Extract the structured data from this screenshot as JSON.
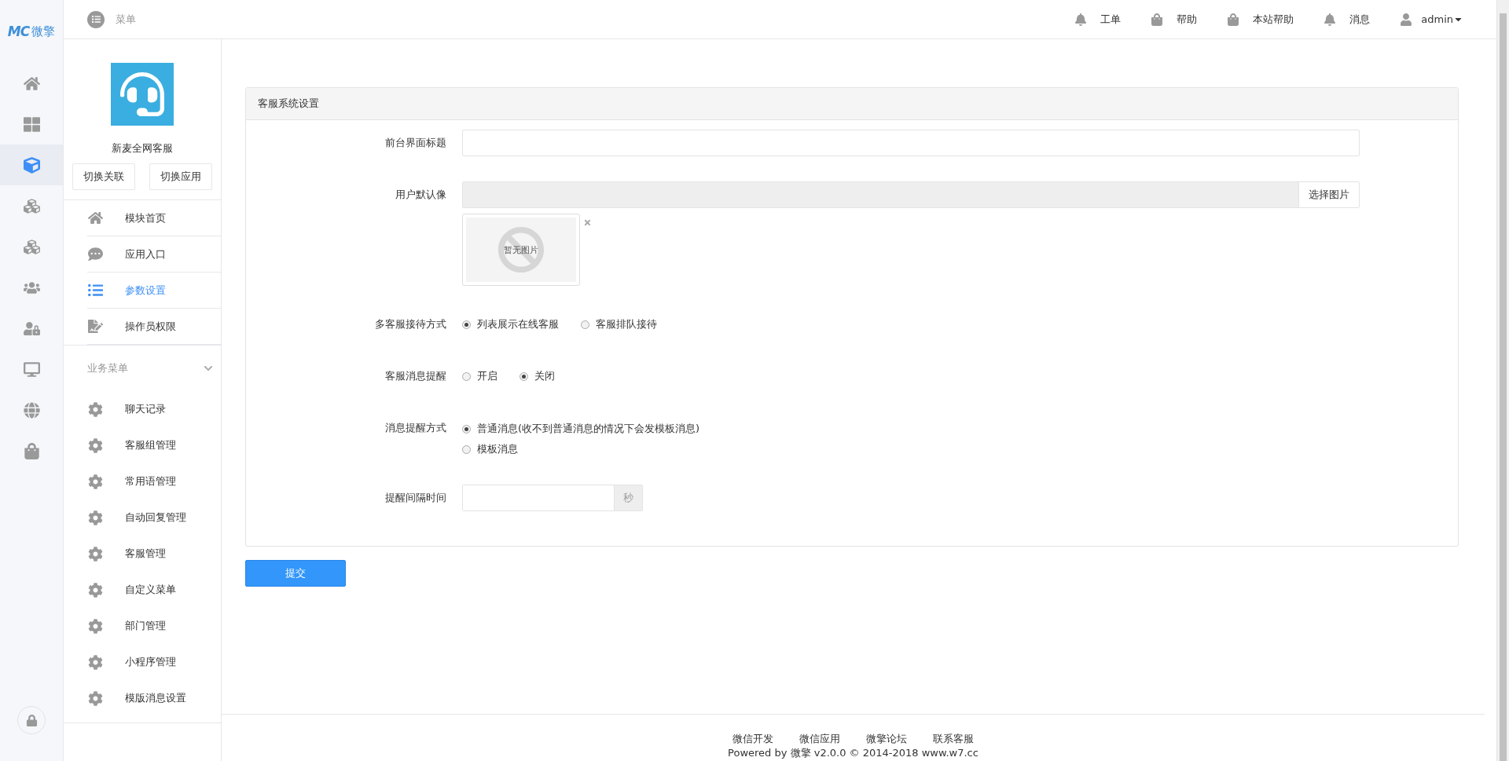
{
  "rail": {
    "logo_mark": "MC",
    "logo_name": "微擎",
    "items": [
      {
        "selected": false
      },
      {
        "selected": false
      },
      {
        "selected": true
      },
      {
        "selected": false
      },
      {
        "selected": false
      },
      {
        "selected": false
      },
      {
        "selected": false
      },
      {
        "selected": false
      },
      {
        "selected": false
      },
      {
        "selected": false
      }
    ]
  },
  "topbar": {
    "menu_label": "菜单",
    "links": [
      {
        "label": "工单",
        "kind": "bell"
      },
      {
        "label": "帮助",
        "kind": "bag"
      },
      {
        "label": "本站帮助",
        "kind": "bag"
      },
      {
        "label": "消息",
        "kind": "bell"
      }
    ],
    "user": "admin"
  },
  "sidebar": {
    "app_name": "新麦全网客服",
    "buttons": [
      "切换关联",
      "切换应用"
    ],
    "nav": [
      {
        "label": "模块首页",
        "kind": "home",
        "selected": false
      },
      {
        "label": "应用入口",
        "kind": "chat",
        "selected": false
      },
      {
        "label": "参数设置",
        "kind": "list",
        "selected": true
      },
      {
        "label": "操作员权限",
        "kind": "doc",
        "selected": false
      }
    ],
    "section": {
      "title": "业务菜单",
      "expanded": true,
      "items": [
        "聊天记录",
        "客服组管理",
        "常用语管理",
        "自动回复管理",
        "客服管理",
        "自定义菜单",
        "部门管理",
        "小程序管理",
        "模版消息设置"
      ]
    }
  },
  "panel": {
    "title": "客服系统设置",
    "fields": [
      {
        "kind": "text",
        "label": "前台界面标题"
      },
      {
        "kind": "image",
        "label": "用户默认像",
        "button": "选择图片",
        "preview": "暂无图片"
      },
      {
        "kind": "radio",
        "label": "多客服接待方式",
        "stacked": false,
        "options": [
          {
            "label": "列表展示在线客服",
            "selected": true
          },
          {
            "label": "客服排队接待",
            "selected": false
          }
        ]
      },
      {
        "kind": "radio",
        "label": "客服消息提醒",
        "stacked": false,
        "options": [
          {
            "label": "开启",
            "selected": false
          },
          {
            "label": "关闭",
            "selected": true
          }
        ]
      },
      {
        "kind": "radio",
        "label": "消息提醒方式",
        "stacked": true,
        "options": [
          {
            "label": "普通消息(收不到普通消息的情况下会发模板消息)",
            "selected": true
          },
          {
            "label": "模板消息",
            "selected": false
          }
        ]
      },
      {
        "kind": "addon",
        "label": "提醒间隔时间",
        "addon": "秒"
      }
    ]
  },
  "submit": "提交",
  "footer": {
    "links": [
      "微信开发",
      "微信应用",
      "微擎论坛",
      "联系客服"
    ],
    "powered": "Powered by 微擎 v2.0.0 © 2014-2018 www.w7.cc"
  }
}
